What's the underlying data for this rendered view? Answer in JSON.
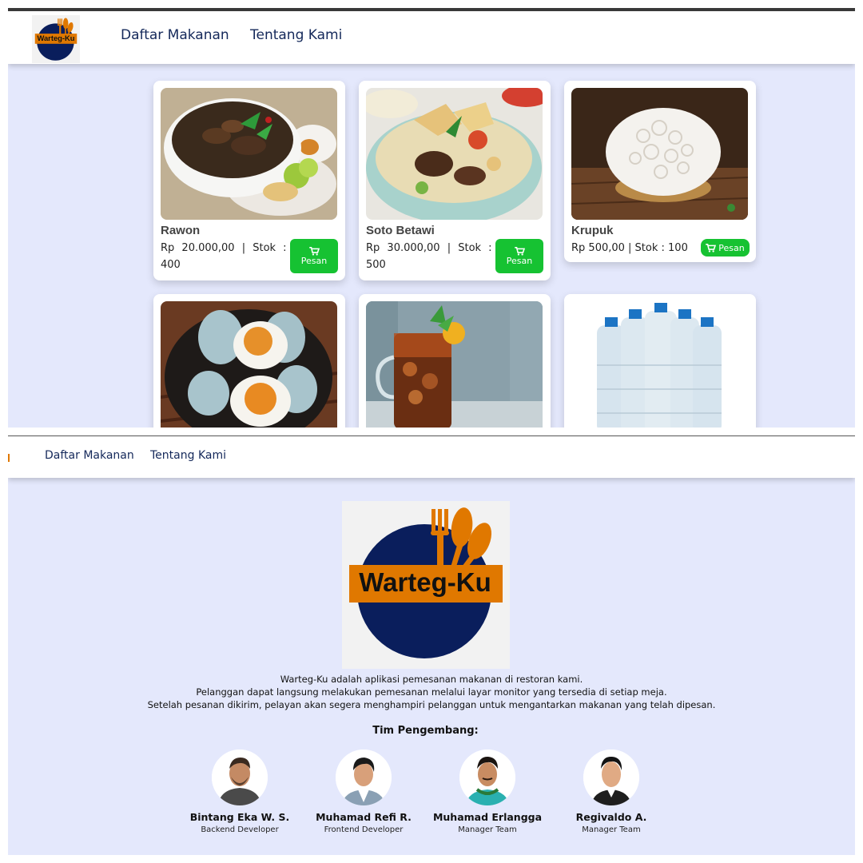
{
  "app": {
    "logo_text": "Warteg-Ku",
    "colors": {
      "navy": "#0a1e5c",
      "orange": "#e07800",
      "green": "#16c232",
      "page_bg": "#e4e8fc"
    }
  },
  "menu_screen": {
    "nav": {
      "link_menu": "Daftar Makanan",
      "link_about": "Tentang Kami"
    },
    "products": [
      {
        "name": "Rawon",
        "price_stock": "Rp 20.000,00 | Stok : 400",
        "button": "Pesan",
        "image_icon": "rawon-image"
      },
      {
        "name": "Soto Betawi",
        "price_stock": "Rp 30.000,00 | Stok : 500",
        "button": "Pesan",
        "image_icon": "soto-betawi-image"
      },
      {
        "name": "Krupuk",
        "price_stock": "Rp 500,00 | Stok : 100",
        "button": "Pesan",
        "image_icon": "krupuk-image"
      },
      {
        "image_icon": "salted-egg-image"
      },
      {
        "image_icon": "iced-tea-image"
      },
      {
        "image_icon": "water-bottles-image"
      }
    ]
  },
  "about_screen": {
    "nav": {
      "link_menu": "Daftar Makanan",
      "link_about": "Tentang Kami"
    },
    "description": [
      "Warteg-Ku adalah aplikasi pemesanan makanan di restoran kami.",
      "Pelanggan dapat langsung melakukan pemesanan melalui layar monitor yang tersedia di setiap meja.",
      "Setelah pesanan dikirim, pelayan akan segera menghampiri pelanggan untuk mengantarkan makanan yang telah dipesan."
    ],
    "team_title": "Tim Pengembang:",
    "team": [
      {
        "name": "Bintang Eka W. S.",
        "role": "Backend Developer"
      },
      {
        "name": "Muhamad Refi R.",
        "role": "Frontend Developer"
      },
      {
        "name": "Muhamad Erlangga",
        "role": "Manager Team"
      },
      {
        "name": "Regivaldo A.",
        "role": "Manager Team"
      }
    ]
  }
}
